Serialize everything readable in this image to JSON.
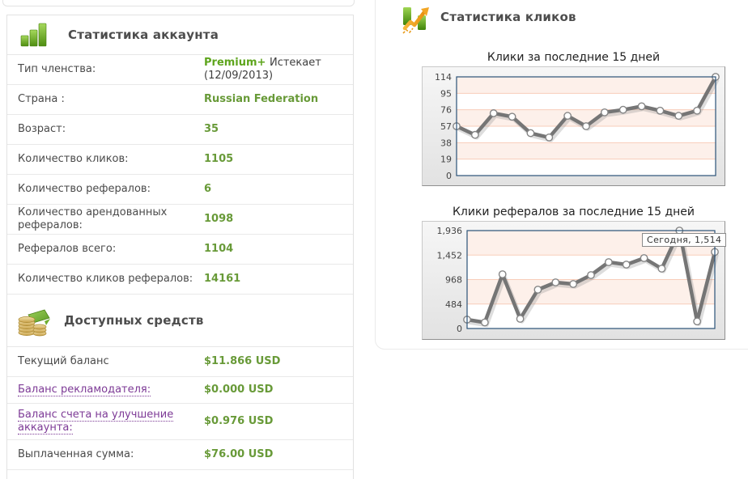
{
  "left_panel": {
    "stats": {
      "title": "Статистика аккаунта",
      "icon": "bar-chart-icon",
      "rows": [
        {
          "label": "Тип членства:",
          "value": "Premium+",
          "suffix": "Истекает (12/09/2013)"
        },
        {
          "label": "Страна :",
          "value": "Russian Federation"
        },
        {
          "label": "Возраст:",
          "value": "35"
        },
        {
          "label": "Количество кликов:",
          "value": "1105"
        },
        {
          "label": "Количество рефералов:",
          "value": "6"
        },
        {
          "label": "Количество арендованных рефералов:",
          "value": "1098"
        },
        {
          "label": "Рефералов всего:",
          "value": "1104"
        },
        {
          "label": "Количество кликов рефералов:",
          "value": "14161"
        }
      ]
    },
    "funds": {
      "title": "Доступных средств",
      "icon": "coins-icon",
      "rows": [
        {
          "label": "Текущий баланс",
          "value": "$11.866 USD",
          "link": false
        },
        {
          "label": "Баланс рекламодателя:",
          "value": "$0.000 USD",
          "link": true
        },
        {
          "label": "Баланс счета на улучшение аккаунта:",
          "value": "$0.976 USD",
          "link": true
        },
        {
          "label": "Выплаченная сумма:",
          "value": "$76.00 USD",
          "link": false
        }
      ]
    }
  },
  "right_panel": {
    "title": "Статистика кликов",
    "icon": "trend-chart-icon"
  },
  "chart_data": [
    {
      "type": "line",
      "title": "Клики за последние 15 дней",
      "xlabel": "",
      "ylabel": "",
      "ylim": [
        0,
        114
      ],
      "y_ticks": [
        114,
        95,
        76,
        57,
        38,
        19,
        0
      ],
      "tick_labels": [
        "114",
        "95",
        "76",
        "57",
        "38",
        "19",
        "0"
      ],
      "x": [
        1,
        2,
        3,
        4,
        5,
        6,
        7,
        8,
        9,
        10,
        11,
        12,
        13,
        14,
        15
      ],
      "values": [
        57,
        47,
        72,
        68,
        49,
        44,
        69,
        57,
        73,
        76,
        80,
        75,
        69,
        75,
        114
      ],
      "grid": "striped",
      "legend": "none"
    },
    {
      "type": "line",
      "title": "Клики рефералов за последние 15 дней",
      "xlabel": "",
      "ylabel": "",
      "ylim": [
        0,
        1936
      ],
      "y_ticks": [
        1936,
        1452,
        968,
        484,
        0
      ],
      "tick_labels": [
        "1,936",
        "1,452",
        "968",
        "484",
        "0"
      ],
      "x": [
        1,
        2,
        3,
        4,
        5,
        6,
        7,
        8,
        9,
        10,
        11,
        12,
        13,
        14,
        15
      ],
      "values": [
        176,
        120,
        1072,
        192,
        768,
        912,
        880,
        1056,
        1312,
        1264,
        1392,
        1184,
        1936,
        140,
        1514
      ],
      "tooltip": "Сегодня, 1,514",
      "grid": "striped",
      "legend": "none"
    }
  ],
  "colors": {
    "value_green": "#689a38",
    "premium_green": "#5ea51d",
    "link_purple": "#7d3a96",
    "chart_line": "#757575",
    "chart_border": "#2a5277",
    "stripe_pink": "#fdf0ea",
    "stripe_line": "#f8cdba",
    "marker_stroke": "#858585"
  }
}
